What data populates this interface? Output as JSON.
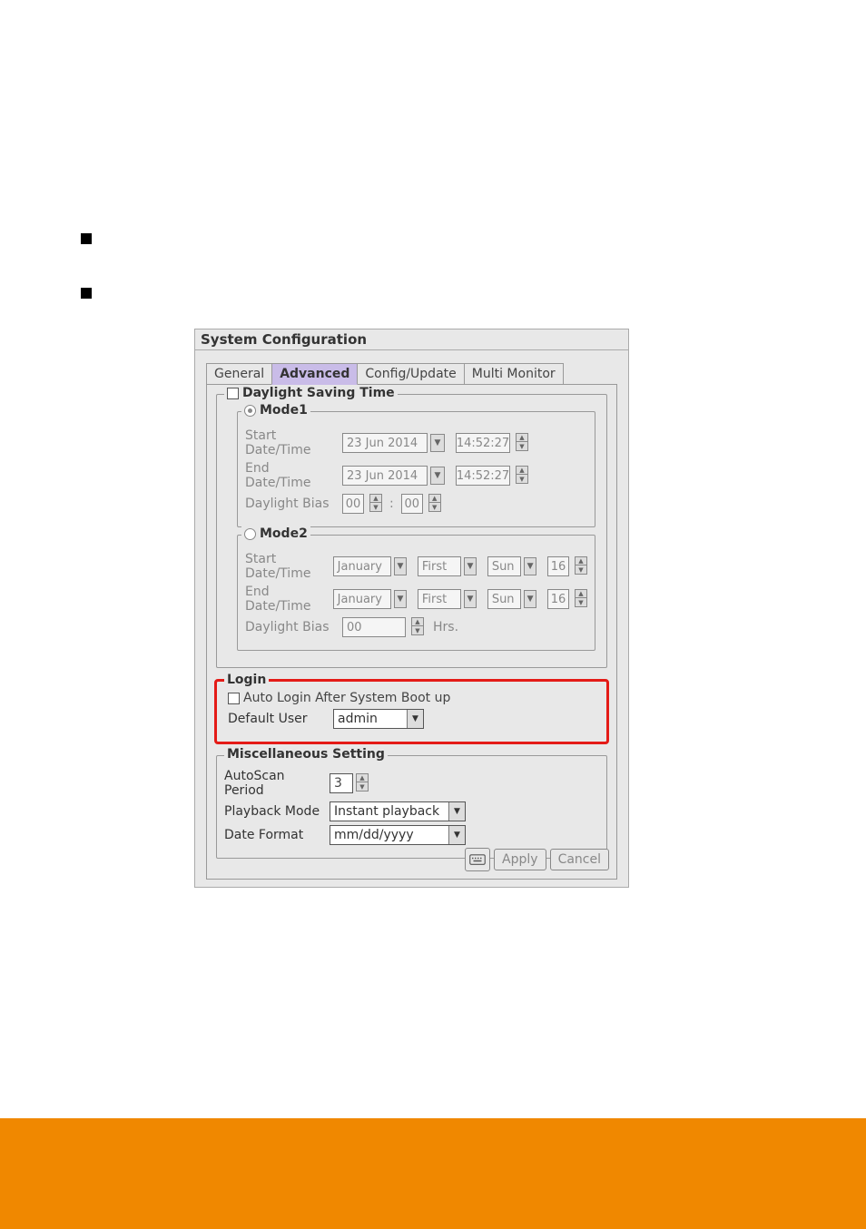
{
  "window": {
    "title": "System Configuration"
  },
  "tabs": {
    "general": "General",
    "advanced": "Advanced",
    "config_update": "Config/Update",
    "multi_monitor": "Multi Monitor"
  },
  "dst": {
    "legend": "Daylight Saving Time",
    "mode1": {
      "legend": "Mode1",
      "start_label": "Start Date/Time",
      "end_label": "End Date/Time",
      "bias_label": "Daylight Bias",
      "start_date": "23 Jun 2014",
      "start_time": "14:52:27",
      "end_date": "23 Jun 2014",
      "end_time": "14:52:27",
      "bias_h": "00",
      "bias_m": "00"
    },
    "mode2": {
      "legend": "Mode2",
      "start_label": "Start Date/Time",
      "end_label": "End Date/Time",
      "bias_label": "Daylight Bias",
      "start_month": "January",
      "start_which": "First",
      "start_day": "Sun",
      "start_hour": "16",
      "end_month": "January",
      "end_which": "First",
      "end_day": "Sun",
      "end_hour": "16",
      "bias": "00",
      "hrs": "Hrs."
    }
  },
  "login": {
    "legend": "Login",
    "auto_label": "Auto Login After System Boot up",
    "default_label": "Default User",
    "default_value": "admin"
  },
  "misc": {
    "legend": "Miscellaneous Setting",
    "autoscan_label": "AutoScan Period",
    "autoscan_value": "3",
    "playback_label": "Playback Mode",
    "playback_value": "Instant playback",
    "dateformat_label": "Date Format",
    "dateformat_value": "mm/dd/yyyy"
  },
  "buttons": {
    "apply": "Apply",
    "cancel": "Cancel"
  }
}
